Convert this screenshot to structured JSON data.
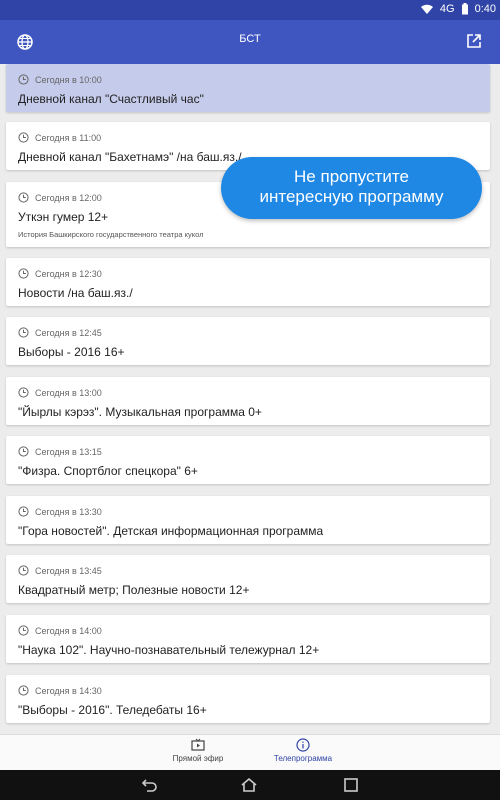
{
  "status_bar": {
    "signal": "4G",
    "time": "0:40"
  },
  "app_bar": {
    "title": "БСТ",
    "left_icon": "globe-icon",
    "right_icon": "external-link-icon"
  },
  "colors": {
    "app_bar": "#3f56c0",
    "status_bar": "#2f44a6",
    "accent": "#1f88e4",
    "selected_card": "#c5cbea"
  },
  "programs": [
    {
      "time": "Сегодня в 10:00",
      "title": "Дневной канал \"Счастливый час\"",
      "description": ""
    },
    {
      "time": "Сегодня в 11:00",
      "title": "Дневной канал \"Бахетнамэ\" /на баш.яз./",
      "description": ""
    },
    {
      "time": "Сегодня в 12:00",
      "title": "Уткэн гумер 12+",
      "description": "История Башкирского государственного  театра кукол"
    },
    {
      "time": "Сегодня в 12:30",
      "title": "Новости /на баш.яз./",
      "description": ""
    },
    {
      "time": "Сегодня в 12:45",
      "title": "Выборы - 2016 16+",
      "description": ""
    },
    {
      "time": "Сегодня в 13:00",
      "title": "\"Йырлы кэрэз\". Музыкальная программа 0+",
      "description": ""
    },
    {
      "time": "Сегодня в 13:15",
      "title": "\"Физра. Спортблог спецкора\" 6+",
      "description": ""
    },
    {
      "time": "Сегодня в 13:30",
      "title": "\"Гора новостей\". Детская информационная программа",
      "description": ""
    },
    {
      "time": "Сегодня в 13:45",
      "title": "Квадратный метр; Полезные новости 12+",
      "description": ""
    },
    {
      "time": "Сегодня в 14:00",
      "title": "\"Наука 102\". Научно-познавательный тележурнал 12+",
      "description": ""
    },
    {
      "time": "Сегодня в 14:30",
      "title": "\"Выборы - 2016\". Теледебаты 16+",
      "description": ""
    }
  ],
  "tooltip": {
    "line1": "Не пропустите",
    "line2": "интересную программу"
  },
  "bottom_nav": {
    "live_label": "Прямой эфир",
    "guide_label": "Телепрограмма"
  }
}
